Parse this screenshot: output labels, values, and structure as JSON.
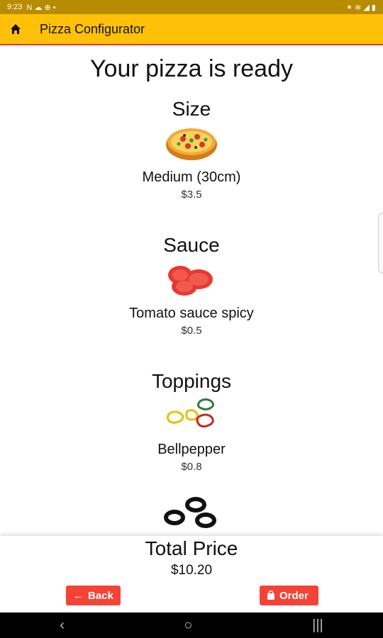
{
  "status_bar": {
    "time": "9:23",
    "left_icons": "N ☁ ⊕ •",
    "right_icons": "✶ ≋ ◢ ▮"
  },
  "app_bar": {
    "title": "Pizza Configurator"
  },
  "page_title": "Your pizza is ready",
  "sections": [
    {
      "heading": "Size",
      "item": "Medium (30cm)",
      "price": "$3.5",
      "icon": "pizza-icon"
    },
    {
      "heading": "Sauce",
      "item": "Tomato sauce spicy",
      "price": "$0.5",
      "icon": "tomato-slices-icon"
    },
    {
      "heading": "Toppings",
      "item": "Bellpepper",
      "price": "$0.8",
      "icon": "bellpepper-rings-icon"
    },
    {
      "heading": "",
      "item": "",
      "price": "",
      "icon": "olive-rings-icon"
    }
  ],
  "total": {
    "label": "Total Price",
    "value": "$10.20"
  },
  "buttons": {
    "back": "Back",
    "order": "Order"
  },
  "colors": {
    "app_bar": "#ffc107",
    "accent": "#f44336",
    "status_bar": "#b88c00"
  }
}
